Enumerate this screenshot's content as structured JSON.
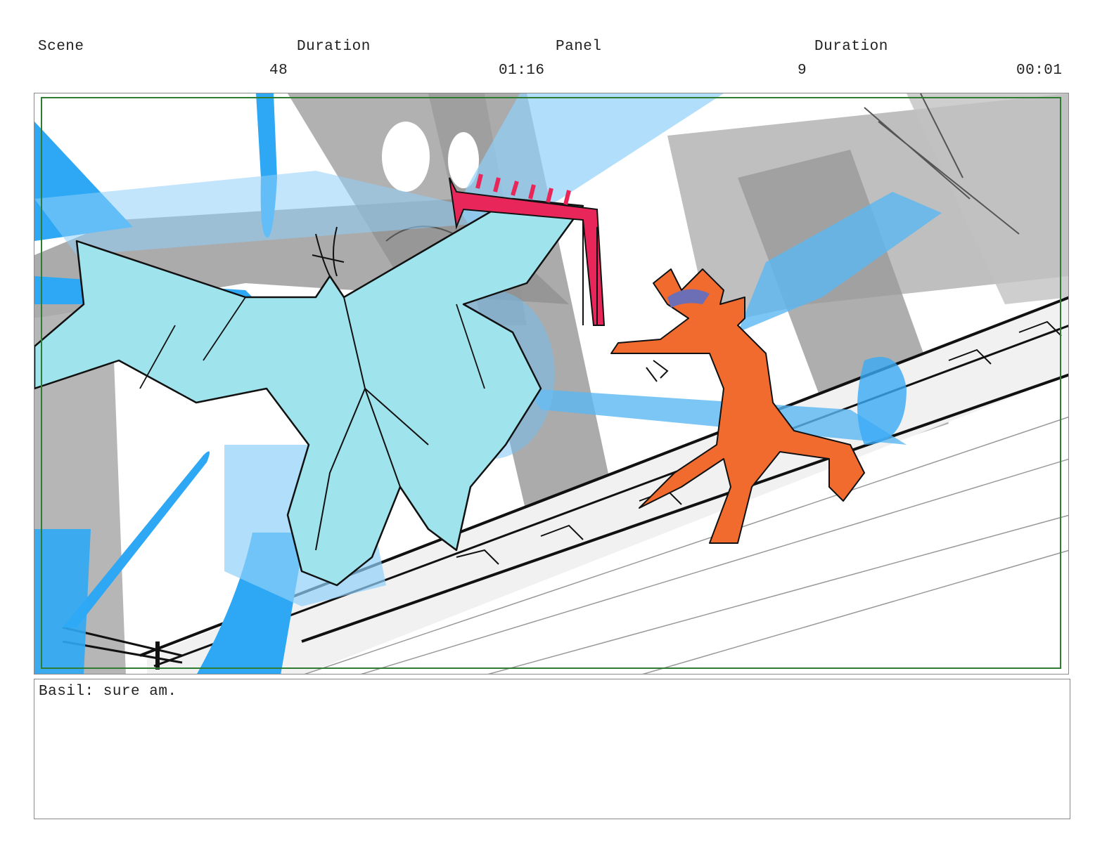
{
  "header": {
    "scene_label": "Scene",
    "scene_duration_label": "Duration",
    "panel_label": "Panel",
    "panel_duration_label": "Duration",
    "scene_value": "48",
    "scene_duration_value": "01:16",
    "panel_value": "9",
    "panel_duration_value": "00:01"
  },
  "notes": {
    "dialogue": "Basil: sure am."
  },
  "colors": {
    "safe_area_border": "#2e7d32",
    "dragon": "#9fe3ec",
    "character": "#f26b2e",
    "sword": "#e8265a",
    "energy_blue": "#2ea8f5",
    "background_gray": "#a6a6a6"
  }
}
